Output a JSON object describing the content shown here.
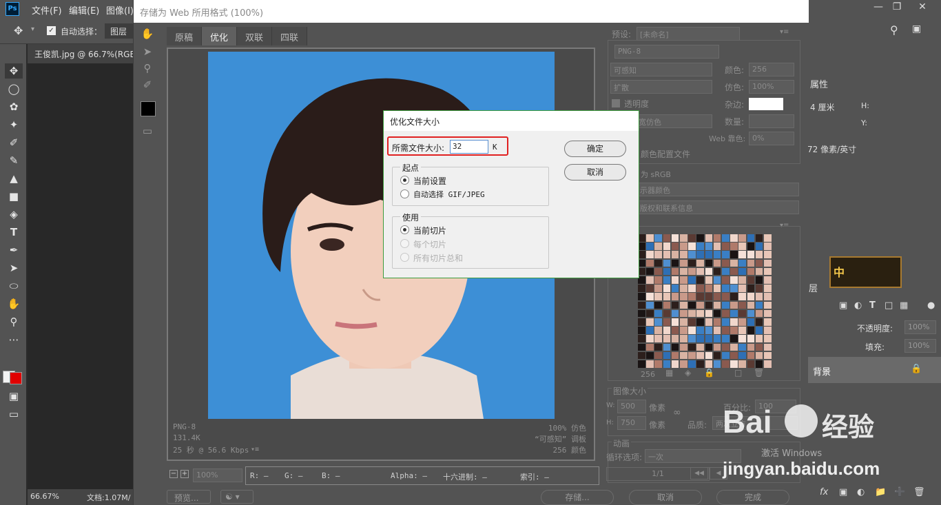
{
  "photoshop": {
    "menu": [
      "文件(F)",
      "编辑(E)",
      "图像(I)"
    ],
    "options": {
      "auto_select_label": "自动选择：",
      "auto_select_value": "图层"
    },
    "doc_tab": "王俊凯.jpg @ 66.7%(RGB/",
    "status_zoom": "66.67%",
    "status_doc": "文档:1.07M/",
    "logo": "Ps"
  },
  "right_panel": {
    "properties_label": "属性",
    "width_unit": "4 厘米",
    "h_label": "H:",
    "y_label": "Y:",
    "resolution": "72 像素/英寸",
    "layers_tab_partial": "层",
    "opacity_label": "不透明度:",
    "opacity_value": "100%",
    "fill_label": "填充:",
    "fill_value": "100%",
    "layer_name": "背景",
    "fx_label": "fx",
    "game_badge": "中"
  },
  "sfw": {
    "title": "存储为 Web 所用格式 (100%)",
    "tabs": [
      "原稿",
      "优化",
      "双联",
      "四联"
    ],
    "info_left": [
      "PNG-8",
      "131.4K",
      "25 秒 @ 56.6 Kbps"
    ],
    "info_right": [
      "100% 仿色",
      "“可感知” 调板",
      "256 颜色"
    ],
    "zoom_value": "100%",
    "readout": {
      "r": "R: —",
      "g": "G: —",
      "b": "B: —",
      "alpha": "Alpha: —",
      "hex": "十六进制: —",
      "index": "索引: —"
    },
    "preview_button": "预览...",
    "save_button": "存储...",
    "cancel_button": "取消",
    "done_button": "完成",
    "settings": {
      "preset_label": "预设:",
      "preset_value": "[未命名]",
      "format": "PNG-8",
      "reduction": "可感知",
      "dither_algo": "扩散",
      "transparency": "透明度",
      "matte_partial": "宽仿色",
      "colors_label": "颜色:",
      "colors_value": "256",
      "dither_label": "仿色:",
      "dither_value": "100%",
      "matte_label": "杂边:",
      "amount_label": "数量:",
      "websnap_label": "Web 靠色:",
      "websnap_value": "0%",
      "embed_profile_partial": "颜色配置文件",
      "convert_srgb_partial": "为 sRGB",
      "preview_partial": "示器颜色",
      "metadata_partial": "版权和联系信息",
      "color_count": "256"
    },
    "image_size": {
      "title": "图像大小",
      "w_label": "W:",
      "w_value": "500",
      "h_label": "H:",
      "h_value": "750",
      "unit": "像素",
      "percent_label": "百分比:",
      "percent_value": "100",
      "quality_label": "品质:",
      "quality_value": "两次立方"
    },
    "animation": {
      "title": "动画",
      "loop_label": "循环选项:",
      "loop_value": "一次",
      "frame": "1/1"
    }
  },
  "dialog": {
    "title": "优化文件大小",
    "target_label": "所需文件大小:",
    "target_value": "32",
    "unit": "K",
    "ok": "确定",
    "cancel": "取消",
    "start_title": "起点",
    "start_options": [
      "当前设置",
      "自动选择 GIF/JPEG"
    ],
    "use_title": "使用",
    "use_options": [
      "当前切片",
      "每个切片",
      "所有切片总和"
    ]
  },
  "watermark": {
    "brand": "Bai",
    "brand_cn": "经验",
    "url": "jingyan.baidu.com",
    "activate": "激活 Windows"
  },
  "palette_colors": [
    "#2c1f1c",
    "#d9b3a3",
    "#3a7fc4",
    "#e8c6b7",
    "#5a3a33",
    "#f1d7cc",
    "#4f8fd0",
    "#1a1414",
    "#c99a8a",
    "#8a5a4f",
    "#e3bfb2",
    "#2e6fb5",
    "#f5e1d8",
    "#b07a6a"
  ],
  "colors": {
    "accent_red": "#e02020",
    "sky": "#3d8fd6",
    "ok_green": "#3c9c3c"
  }
}
